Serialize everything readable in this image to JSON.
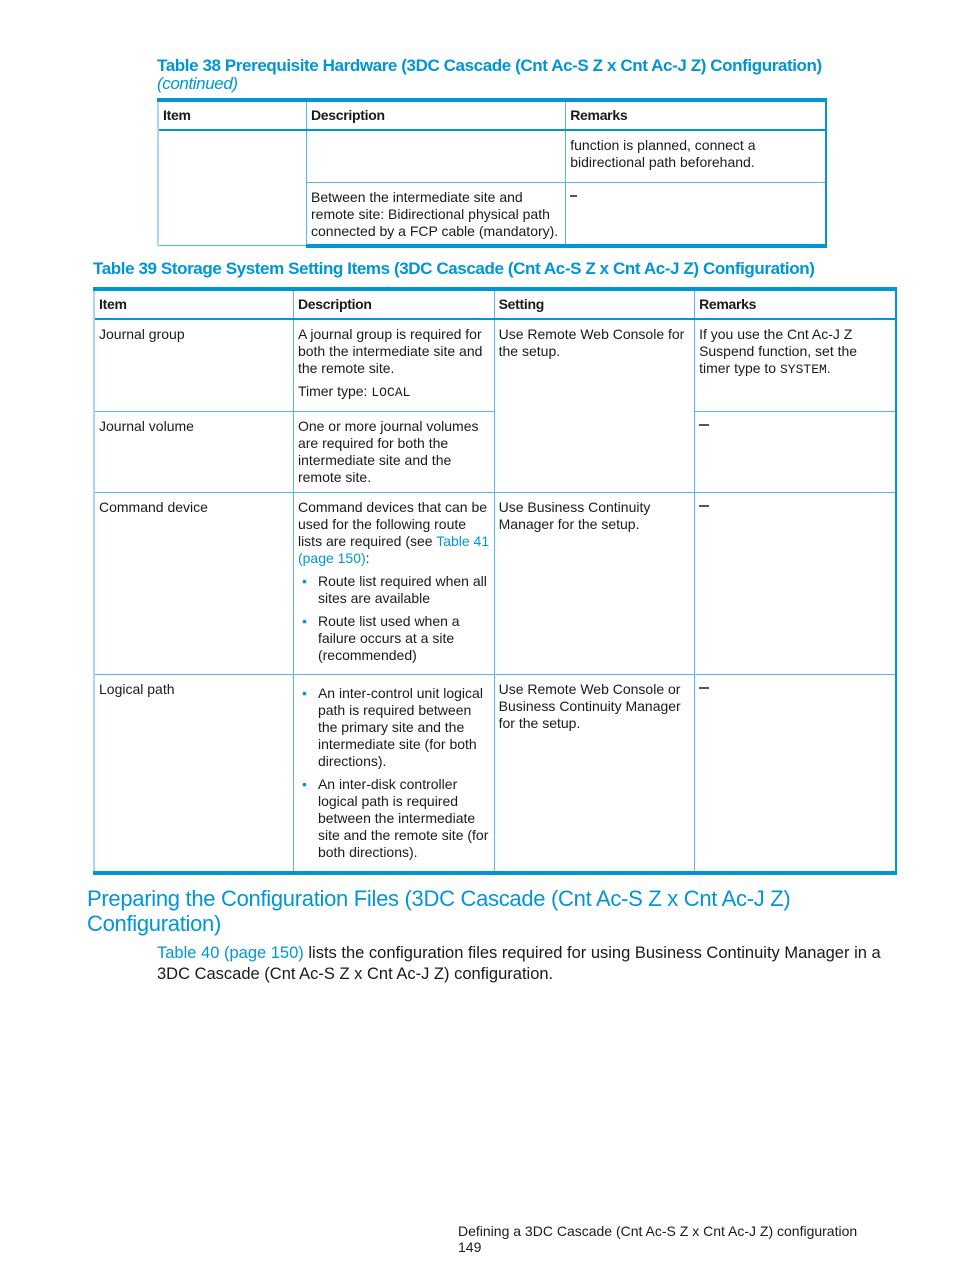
{
  "table38": {
    "caption": "Table 38 Prerequisite Hardware (3DC Cascade (Cnt Ac-S Z x Cnt Ac-J Z) Configuration)",
    "continued": "(continued)",
    "headers": [
      "Item",
      "Description",
      "Remarks"
    ],
    "rows": [
      {
        "item": "",
        "description": "",
        "remarks": "function is planned, connect a bidirectional path beforehand."
      },
      {
        "description": "Between the intermediate site and remote site: Bidirectional physical path connected by a FCP cable (mandatory).",
        "remarks": "–"
      }
    ]
  },
  "table39": {
    "caption": "Table 39 Storage System Setting Items (3DC Cascade (Cnt Ac-S Z x Cnt Ac-J Z) Configuration)",
    "headers": [
      "Item",
      "Description",
      "Setting",
      "Remarks"
    ],
    "rows": [
      {
        "item": "Journal group",
        "description": "A journal group is required for both the intermediate site and the remote site.",
        "timer_label": "Timer type: ",
        "timer_value": "LOCAL",
        "setting": "Use Remote Web Console for the setup.",
        "remarks_pre": "If you use the Cnt Ac-J Z Suspend function, set the timer type to ",
        "remarks_code": "SYSTEM",
        "remarks_post": "."
      },
      {
        "item": "Journal volume",
        "description": "One or more journal volumes are required for both the intermediate site and the remote site.",
        "remarks": "—"
      },
      {
        "item": "Command device",
        "description_pre": "Command devices that can be used for the following route lists are required (see ",
        "description_link": "Table 41 (page 150)",
        "description_post": ":",
        "bullets": [
          "Route list required when all sites are available",
          "Route list used when a failure occurs at a site (recommended)"
        ],
        "setting": "Use Business Continuity Manager for the setup.",
        "remarks": "—"
      },
      {
        "item": "Logical path",
        "bullets": [
          "An inter-control unit logical path is required between the primary site and the intermediate site (for both directions).",
          "An inter-disk controller logical path is required between the intermediate site and the remote site (for both directions)."
        ],
        "setting": "Use Remote Web Console or Business Continuity Manager for the setup.",
        "remarks": "—"
      }
    ]
  },
  "section": {
    "heading": "Preparing the Configuration Files (3DC Cascade (Cnt Ac-S Z x Cnt Ac-J Z) Configuration)",
    "link": "Table 40 (page 150)",
    "body": " lists the configuration files required for using Business Continuity Manager in a 3DC Cascade (Cnt Ac-S Z x Cnt Ac-J Z) configuration."
  },
  "footer": {
    "title": "Defining a 3DC Cascade (Cnt Ac-S Z x Cnt Ac-J Z) configuration",
    "page": "149"
  }
}
